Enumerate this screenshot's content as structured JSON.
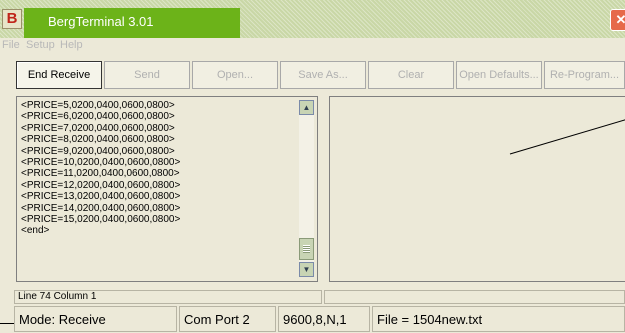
{
  "window": {
    "title": "BergTerminal 3.01",
    "icon_letter": "B",
    "close_glyph": "✕"
  },
  "menu": [
    "File",
    "Setup",
    "Help"
  ],
  "toolbar": {
    "end_receive": "End Receive",
    "send": "Send",
    "open": "Open...",
    "save_as": "Save As...",
    "clear": "Clear",
    "open_defaults": "Open Defaults...",
    "re_program": "Re-Program..."
  },
  "log_lines": [
    "<PRICE=5,0200,0400,0600,0800>",
    "<PRICE=6,0200,0400,0600,0800>",
    "<PRICE=7,0200,0400,0600,0800>",
    "<PRICE=8,0200,0400,0600,0800>",
    "<PRICE=9,0200,0400,0600,0800>",
    "<PRICE=10,0200,0400,0600,0800>",
    "<PRICE=11,0200,0400,0600,0800>",
    "<PRICE=12,0200,0400,0600,0800>",
    "<PRICE=13,0200,0400,0600,0800>",
    "<PRICE=14,0200,0400,0600,0800>",
    "<PRICE=15,0200,0400,0600,0800>",
    "<end>"
  ],
  "status": {
    "position": "Line 74 Column 1",
    "mode": "Mode: Receive",
    "port": "Com Port 2",
    "settings": "9600,8,N,1",
    "file": "File = 1504new.txt"
  },
  "icons": {
    "scroll_up": "scroll-up-arrow",
    "scroll_down": "scroll-down-arrow",
    "close": "close-x"
  }
}
